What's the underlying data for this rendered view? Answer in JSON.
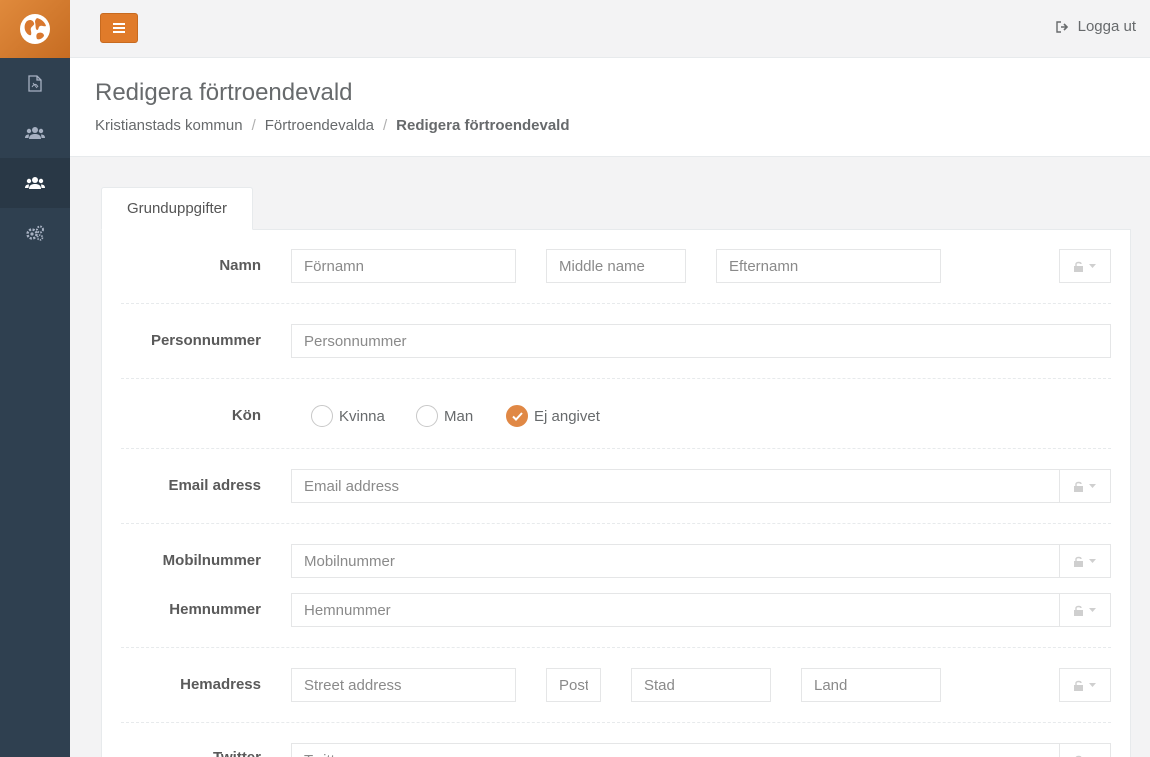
{
  "topbar": {
    "logout_label": "Logga ut"
  },
  "heading": {
    "title": "Redigera förtroendevald",
    "breadcrumb": [
      "Kristianstads kommun",
      "Förtroendevalda",
      "Redigera förtroendevald"
    ]
  },
  "tabs": [
    {
      "label": "Grunduppgifter",
      "active": true
    }
  ],
  "form": {
    "namn": {
      "label": "Namn",
      "first_placeholder": "Förnamn",
      "middle_placeholder": "Middle name",
      "last_placeholder": "Efternamn"
    },
    "personnummer": {
      "label": "Personnummer",
      "placeholder": "Personnummer"
    },
    "kon": {
      "label": "Kön",
      "options": [
        "Kvinna",
        "Man",
        "Ej angivet"
      ],
      "selected": "Ej angivet"
    },
    "email": {
      "label": "Email adress",
      "placeholder": "Email address"
    },
    "mobil": {
      "label": "Mobilnummer",
      "placeholder": "Mobilnummer"
    },
    "hem": {
      "label": "Hemnummer",
      "placeholder": "Hemnummer"
    },
    "hemadress": {
      "label": "Hemadress",
      "street_placeholder": "Street address",
      "post_placeholder": "Post",
      "stad_placeholder": "Stad",
      "land_placeholder": "Land"
    },
    "twitter": {
      "label": "Twitter",
      "placeholder": "Twitter"
    }
  },
  "colors": {
    "accent": "#e07b2a",
    "sidebar": "#2f4050",
    "sidebar_active": "#293846"
  }
}
